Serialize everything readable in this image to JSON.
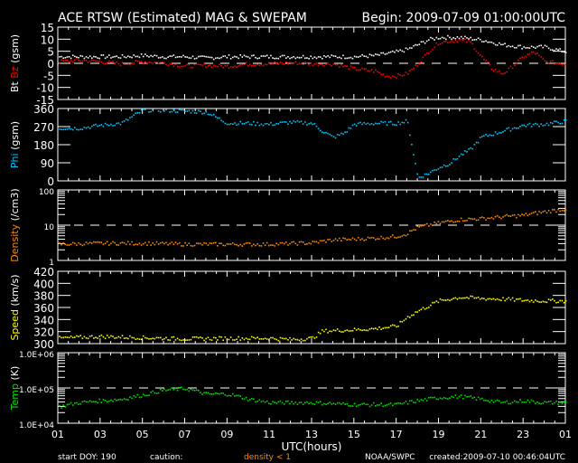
{
  "title": "ACE RTSW (Estimated) MAG & SWEPAM",
  "begin": "Begin: 2009-07-09 01:00:00UTC",
  "footer": {
    "start_doy": "start DOY: 190",
    "caution": "caution:",
    "density_note": "density < 1",
    "source": "NOAA/SWPC",
    "created": "created:2009-07-10 00:46:04UTC"
  },
  "colors": {
    "bt": "#ffffff",
    "bz": "#ff0000",
    "phi": "#00c8ff",
    "density": "#ff8c00",
    "speed": "#ffff00",
    "temp": "#00e000"
  },
  "chart_data": [
    {
      "type": "scatter",
      "id": "mag",
      "ylabel_parts": [
        "Bt",
        "Bz",
        "(gsm)"
      ],
      "yticks": [
        "15",
        "10",
        "5",
        "0",
        "-5",
        "-10",
        "-15"
      ],
      "ytick_values": [
        15,
        10,
        5,
        0,
        -5,
        -10,
        -15
      ],
      "ylim": [
        -15,
        15
      ],
      "dashed_ref": 0,
      "series": [
        {
          "name": "Bt",
          "x": [
            0,
            1,
            2,
            3,
            4,
            5,
            6,
            7,
            8,
            9,
            10,
            11,
            12,
            13,
            14,
            15,
            16,
            16.5,
            17,
            17.5,
            18,
            19,
            20,
            21,
            22,
            23,
            23.5,
            24
          ],
          "y": [
            3,
            3,
            3,
            3,
            3.5,
            3,
            3,
            2.5,
            3,
            3,
            3,
            3,
            3,
            3,
            3,
            3.5,
            5,
            6,
            8,
            10,
            11,
            11,
            10,
            8,
            7,
            7,
            6,
            5
          ]
        },
        {
          "name": "Bz",
          "x": [
            0,
            1,
            2,
            3,
            4,
            5,
            6,
            7,
            8,
            9,
            10,
            11,
            12,
            13,
            13.5,
            14,
            15,
            15.5,
            16,
            16.5,
            17,
            17.5,
            18,
            19,
            19.5,
            20,
            20.5,
            21,
            21.2,
            22,
            22.5,
            23,
            24
          ],
          "y": [
            1,
            1.5,
            1,
            0,
            1,
            0.5,
            -1,
            -0.5,
            -1,
            0,
            0,
            0.5,
            0,
            0,
            -1,
            -2,
            -3,
            -5,
            -5,
            -4,
            0,
            5,
            9,
            10,
            9,
            3,
            -2,
            -4,
            -3,
            3,
            5,
            1,
            0
          ]
        }
      ]
    },
    {
      "type": "scatter",
      "id": "phi",
      "ylabel_parts": [
        "Phi",
        "(gsm)"
      ],
      "yticks": [
        "360",
        "270",
        "180",
        "90",
        "0"
      ],
      "ytick_values": [
        360,
        270,
        180,
        90,
        0
      ],
      "ylim": [
        0,
        360
      ],
      "series": [
        {
          "name": "Phi",
          "x": [
            0,
            1,
            2,
            3,
            4,
            5,
            6,
            7,
            8,
            9,
            10,
            11,
            12,
            12.5,
            13,
            13.5,
            14,
            15,
            16,
            16.5,
            17,
            17.5,
            18,
            18.5,
            19,
            19.5,
            20,
            21,
            22,
            23,
            24
          ],
          "y": [
            265,
            265,
            280,
            290,
            355,
            355,
            350,
            345,
            290,
            290,
            285,
            295,
            290,
            250,
            220,
            240,
            285,
            290,
            290,
            300,
            20,
            40,
            70,
            90,
            130,
            160,
            220,
            250,
            280,
            285,
            300
          ]
        }
      ]
    },
    {
      "type": "scatter",
      "id": "density",
      "yscale": "log",
      "ylabel_parts": [
        "Density",
        "(/cm3)"
      ],
      "yticks": [
        "100",
        "10",
        "1"
      ],
      "ytick_values": [
        100,
        10,
        1
      ],
      "ylim": [
        1,
        100
      ],
      "dashed_ref": 10,
      "series": [
        {
          "name": "Density",
          "x": [
            0,
            2,
            4,
            6,
            8,
            10,
            12,
            13,
            14,
            15,
            16,
            16.5,
            17,
            18,
            19,
            20,
            21,
            22,
            23,
            24
          ],
          "y": [
            3,
            3.2,
            3.2,
            3,
            3,
            3,
            3.3,
            4,
            4.2,
            4.5,
            5,
            6,
            9,
            12,
            15,
            16,
            18,
            20,
            25,
            30
          ]
        }
      ]
    },
    {
      "type": "scatter",
      "id": "speed",
      "ylabel_parts": [
        "Speed",
        "(km/s)"
      ],
      "yticks": [
        "420",
        "400",
        "380",
        "360",
        "340",
        "320",
        "300"
      ],
      "ytick_values": [
        420,
        400,
        380,
        360,
        340,
        320,
        300
      ],
      "ylim": [
        300,
        420
      ],
      "series": [
        {
          "name": "Speed",
          "x": [
            0,
            2,
            4,
            6,
            8,
            10,
            11,
            12,
            12.5,
            14,
            15,
            16,
            16.5,
            17,
            18,
            19,
            20,
            21,
            22,
            23,
            24
          ],
          "y": [
            310,
            313,
            311,
            309,
            310,
            310,
            308,
            310,
            322,
            324,
            326,
            330,
            345,
            355,
            372,
            378,
            376,
            375,
            373,
            372,
            372
          ]
        }
      ]
    },
    {
      "type": "scatter",
      "id": "temp",
      "yscale": "log",
      "ylabel_parts": [
        "Temp",
        "(K)"
      ],
      "yticks": [
        "1.0E+06",
        "1.0E+05",
        "1.0E+04"
      ],
      "ytick_values": [
        1000000,
        100000,
        10000
      ],
      "ylim": [
        10000,
        1000000
      ],
      "dashed_ref": 100000,
      "series": [
        {
          "name": "Temp",
          "x": [
            0,
            1,
            2,
            3,
            4,
            5,
            6,
            7,
            8,
            9,
            10,
            12,
            14,
            16,
            17,
            18,
            19,
            20,
            21,
            22,
            23,
            24
          ],
          "y": [
            30000,
            40000,
            45000,
            50000,
            65000,
            90000,
            100000,
            70000,
            70000,
            50000,
            40000,
            40000,
            35000,
            35000,
            45000,
            55000,
            60000,
            50000,
            40000,
            45000,
            40000,
            40000
          ]
        }
      ]
    }
  ],
  "xaxis": {
    "label": "UTC(hours)",
    "ticks": [
      "01",
      "03",
      "05",
      "07",
      "09",
      "11",
      "13",
      "15",
      "17",
      "19",
      "21",
      "23",
      "01"
    ]
  }
}
